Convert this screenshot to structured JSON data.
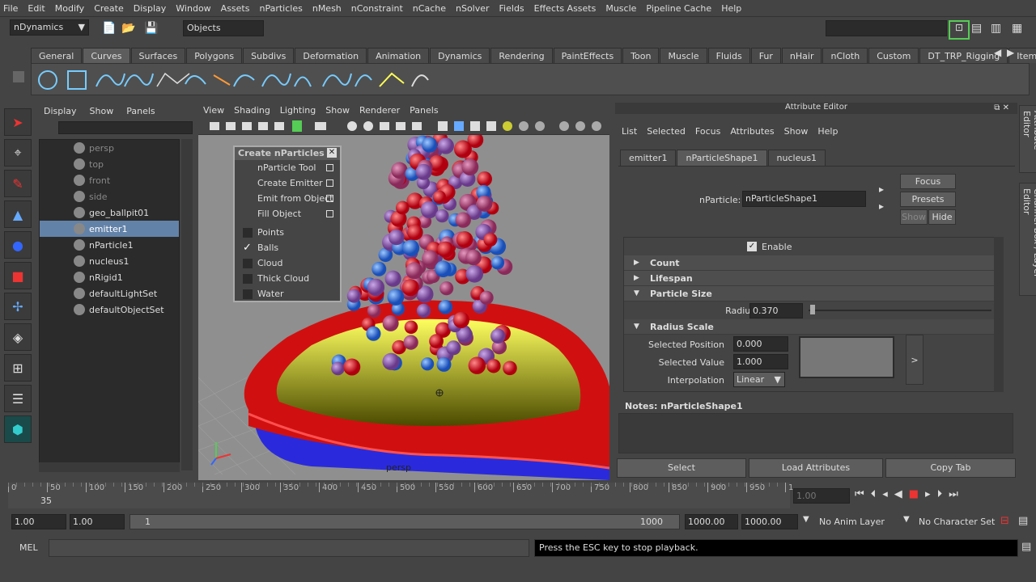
{
  "menubar": [
    "File",
    "Edit",
    "Modify",
    "Create",
    "Display",
    "Window",
    "Assets",
    "nParticles",
    "nMesh",
    "nConstraint",
    "nCache",
    "nSolver",
    "Fields",
    "Effects Assets",
    "Muscle",
    "Pipeline Cache",
    "Help"
  ],
  "status": {
    "menuset": "nDynamics",
    "selmode": "Objects"
  },
  "shelf_tabs": [
    "General",
    "Curves",
    "Surfaces",
    "Polygons",
    "Subdivs",
    "Deformation",
    "Animation",
    "Dynamics",
    "Rendering",
    "PaintEffects",
    "Toon",
    "Muscle",
    "Fluids",
    "Fur",
    "nHair",
    "nCloth",
    "Custom",
    "DT_TRP_Rigging",
    "Item"
  ],
  "shelf_active": "Curves",
  "outliner": {
    "menu": [
      "Display",
      "Show",
      "Panels"
    ],
    "items": [
      {
        "label": "persp",
        "dim": true
      },
      {
        "label": "top",
        "dim": true
      },
      {
        "label": "front",
        "dim": true
      },
      {
        "label": "side",
        "dim": true
      },
      {
        "label": "geo_ballpit01",
        "dim": false
      },
      {
        "label": "emitter1",
        "dim": false,
        "selected": true
      },
      {
        "label": "nParticle1",
        "dim": false
      },
      {
        "label": "nucleus1",
        "dim": false
      },
      {
        "label": "nRigid1",
        "dim": false
      },
      {
        "label": "defaultLightSet",
        "dim": false
      },
      {
        "label": "defaultObjectSet",
        "dim": false
      }
    ]
  },
  "viewport": {
    "menu": [
      "View",
      "Shading",
      "Lighting",
      "Show",
      "Renderer",
      "Panels"
    ],
    "camera": "persp"
  },
  "popup": {
    "title": "Create nParticles",
    "tools": [
      "nParticle Tool",
      "Create Emitter",
      "Emit from Object",
      "Fill Object"
    ],
    "types": [
      {
        "label": "Points",
        "checked": false
      },
      {
        "label": "Balls",
        "checked": true
      },
      {
        "label": "Cloud",
        "checked": false
      },
      {
        "label": "Thick Cloud",
        "checked": false
      },
      {
        "label": "Water",
        "checked": false
      }
    ]
  },
  "ae": {
    "title": "Attribute Editor",
    "menu": [
      "List",
      "Selected",
      "Focus",
      "Attributes",
      "Show",
      "Help"
    ],
    "tabs": [
      "emitter1",
      "nParticleShape1",
      "nucleus1"
    ],
    "active_tab": "nParticleShape1",
    "node_label": "nParticle:",
    "node_value": "nParticleShape1",
    "focus": "Focus",
    "presets": "Presets",
    "show": "Show",
    "hide": "Hide",
    "enable": "Enable",
    "sections": [
      "Count",
      "Lifespan",
      "Particle Size"
    ],
    "radius_label": "Radius",
    "radius_value": "0.370",
    "radius_scale": "Radius Scale",
    "sel_pos_label": "Selected Position",
    "sel_pos": "0.000",
    "sel_val_label": "Selected Value",
    "sel_val": "1.000",
    "interp_label": "Interpolation",
    "interp": "Linear",
    "ramp_btn": ">",
    "notes": "Notes:  nParticleShape1",
    "select": "Select",
    "load": "Load Attributes",
    "copy": "Copy Tab",
    "side_tabs": [
      "Attribute Editor",
      "Channel Box / Layer Editor"
    ]
  },
  "timeline": {
    "ticks": [
      "0",
      "50",
      "100",
      "150",
      "200",
      "250",
      "300",
      "350",
      "400",
      "450",
      "500",
      "550",
      "600",
      "650",
      "700",
      "750",
      "800",
      "850",
      "900",
      "950",
      "1"
    ],
    "current": "35",
    "frame_field": "1.00"
  },
  "range": {
    "start": "1.00",
    "start2": "1.00",
    "slider_left": "1",
    "slider_right": "1000",
    "end": "1000.00",
    "end2": "1000.00",
    "anim_layer": "No Anim Layer",
    "char_set": "No Character Set"
  },
  "cmd": {
    "label": "MEL",
    "feedback": "Press the ESC key to stop playback."
  }
}
